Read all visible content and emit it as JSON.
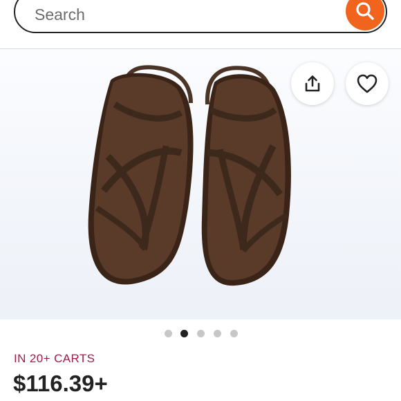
{
  "search": {
    "placeholder": "Search"
  },
  "icons": {
    "search": "search-icon",
    "share": "share-icon",
    "favorite": "heart-icon"
  },
  "product": {
    "image_alt": "Brown leather strappy sandals",
    "carts_badge": "IN 20+ CARTS",
    "price": "$116.39+"
  },
  "carousel": {
    "count": 5,
    "active_index": 1
  },
  "colors": {
    "accent": "#f1641e",
    "badge": "#9e1b4a",
    "leather": "#4a3426",
    "text": "#222222"
  }
}
